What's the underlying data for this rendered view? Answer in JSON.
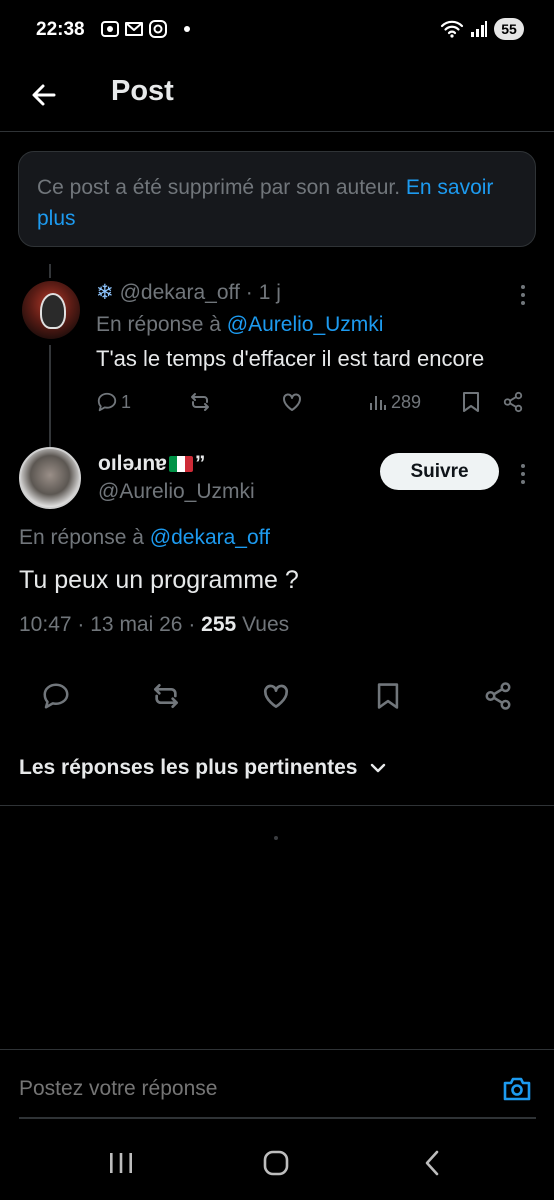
{
  "status_bar": {
    "time": "22:38",
    "battery": "55",
    "icons": [
      "screen-record-icon",
      "gmail-icon",
      "instagram-icon",
      "notification-dot-icon",
      "wifi-icon",
      "signal-icon"
    ]
  },
  "header": {
    "title": "Post",
    "back_icon": "arrow-left-icon"
  },
  "deleted_notice": {
    "text": "Ce post a été supprimé par son auteur. ",
    "link": "En savoir plus"
  },
  "reply_post": {
    "emoji": "❄",
    "handle": "@dekara_off",
    "separator": "·",
    "age": "1 j",
    "reply_prefix": "En réponse à ",
    "reply_to": "@Aurelio_Uzmki",
    "text": "T'as le temps d'effacer il est tard encore",
    "replies": "1",
    "views": "289"
  },
  "main_post": {
    "display_name": "oıləɹnɐ",
    "name_suffix": "”",
    "handle": "@Aurelio_Uzmki",
    "follow_label": "Suivre",
    "reply_prefix": "En réponse à ",
    "reply_to": "@dekara_off",
    "text": "Tu peux un programme ?",
    "time": "10:47",
    "date": "13 mai 26",
    "meta_sep": "·",
    "views_count": "255",
    "views_label": "Vues",
    "flag_colors": [
      "#009246",
      "#ffffff",
      "#ce2b37"
    ]
  },
  "replies_sort": {
    "label": "Les réponses les plus pertinentes"
  },
  "composer": {
    "placeholder": "Postez votre réponse"
  },
  "colors": {
    "accent": "#1d9bf0",
    "background": "#000000",
    "muted_text": "#71767b"
  }
}
